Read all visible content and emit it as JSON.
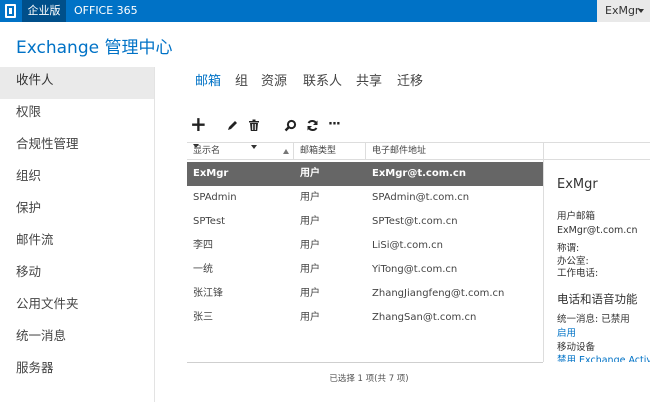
{
  "topbar": {
    "logo_icon": "office-logo-icon",
    "tabs": [
      "企业版",
      "OFFICE 365"
    ],
    "user": "ExMgr"
  },
  "app_title": "Exchange 管理中心",
  "leftnav": {
    "items": [
      "收件人",
      "权限",
      "合规性管理",
      "组织",
      "保护",
      "邮件流",
      "移动",
      "公用文件夹",
      "统一消息",
      "服务器"
    ],
    "active_index": 0
  },
  "subtabs": {
    "items": [
      "邮箱",
      "组",
      "资源",
      "联系人",
      "共享",
      "迁移"
    ],
    "active_index": 0
  },
  "toolbar": {
    "icons": [
      "add-icon",
      "edit-icon",
      "delete-icon",
      "search-icon",
      "refresh-icon",
      "more-icon"
    ],
    "plus": "+",
    "more": "···"
  },
  "table": {
    "columns": [
      "显示名",
      "邮箱类型",
      "电子邮件地址"
    ],
    "rows": [
      {
        "name": "ExMgr",
        "type": "用户",
        "email": "ExMgr@t.com.cn"
      },
      {
        "name": "SPAdmin",
        "type": "用户",
        "email": "SPAdmin@t.com.cn"
      },
      {
        "name": "SPTest",
        "type": "用户",
        "email": "SPTest@t.com.cn"
      },
      {
        "name": "李四",
        "type": "用户",
        "email": "LiSi@t.com.cn"
      },
      {
        "name": "一统",
        "type": "用户",
        "email": "YiTong@t.com.cn"
      },
      {
        "name": "张江锋",
        "type": "用户",
        "email": "ZhangJiangfeng@t.com.cn"
      },
      {
        "name": "张三",
        "type": "用户",
        "email": "ZhangSan@t.com.cn"
      }
    ],
    "selected_index": 0
  },
  "status": "已选择 1 项(共 7 项)",
  "details": {
    "name": "ExMgr",
    "mailbox_label": "用户邮箱",
    "email": "ExMgr@t.com.cn",
    "title_label": "称谓:",
    "office_label": "办公室:",
    "phone_label": "工作电话:",
    "section_title": "电话和语音功能",
    "um_label": "统一消息: 已禁用",
    "um_enable_link": "启用",
    "mobile_label": "移动设备",
    "eas_link": "禁用 Exchange ActiveSync"
  },
  "colors": {
    "brand": "#0072c6",
    "selected_row": "#666666"
  }
}
